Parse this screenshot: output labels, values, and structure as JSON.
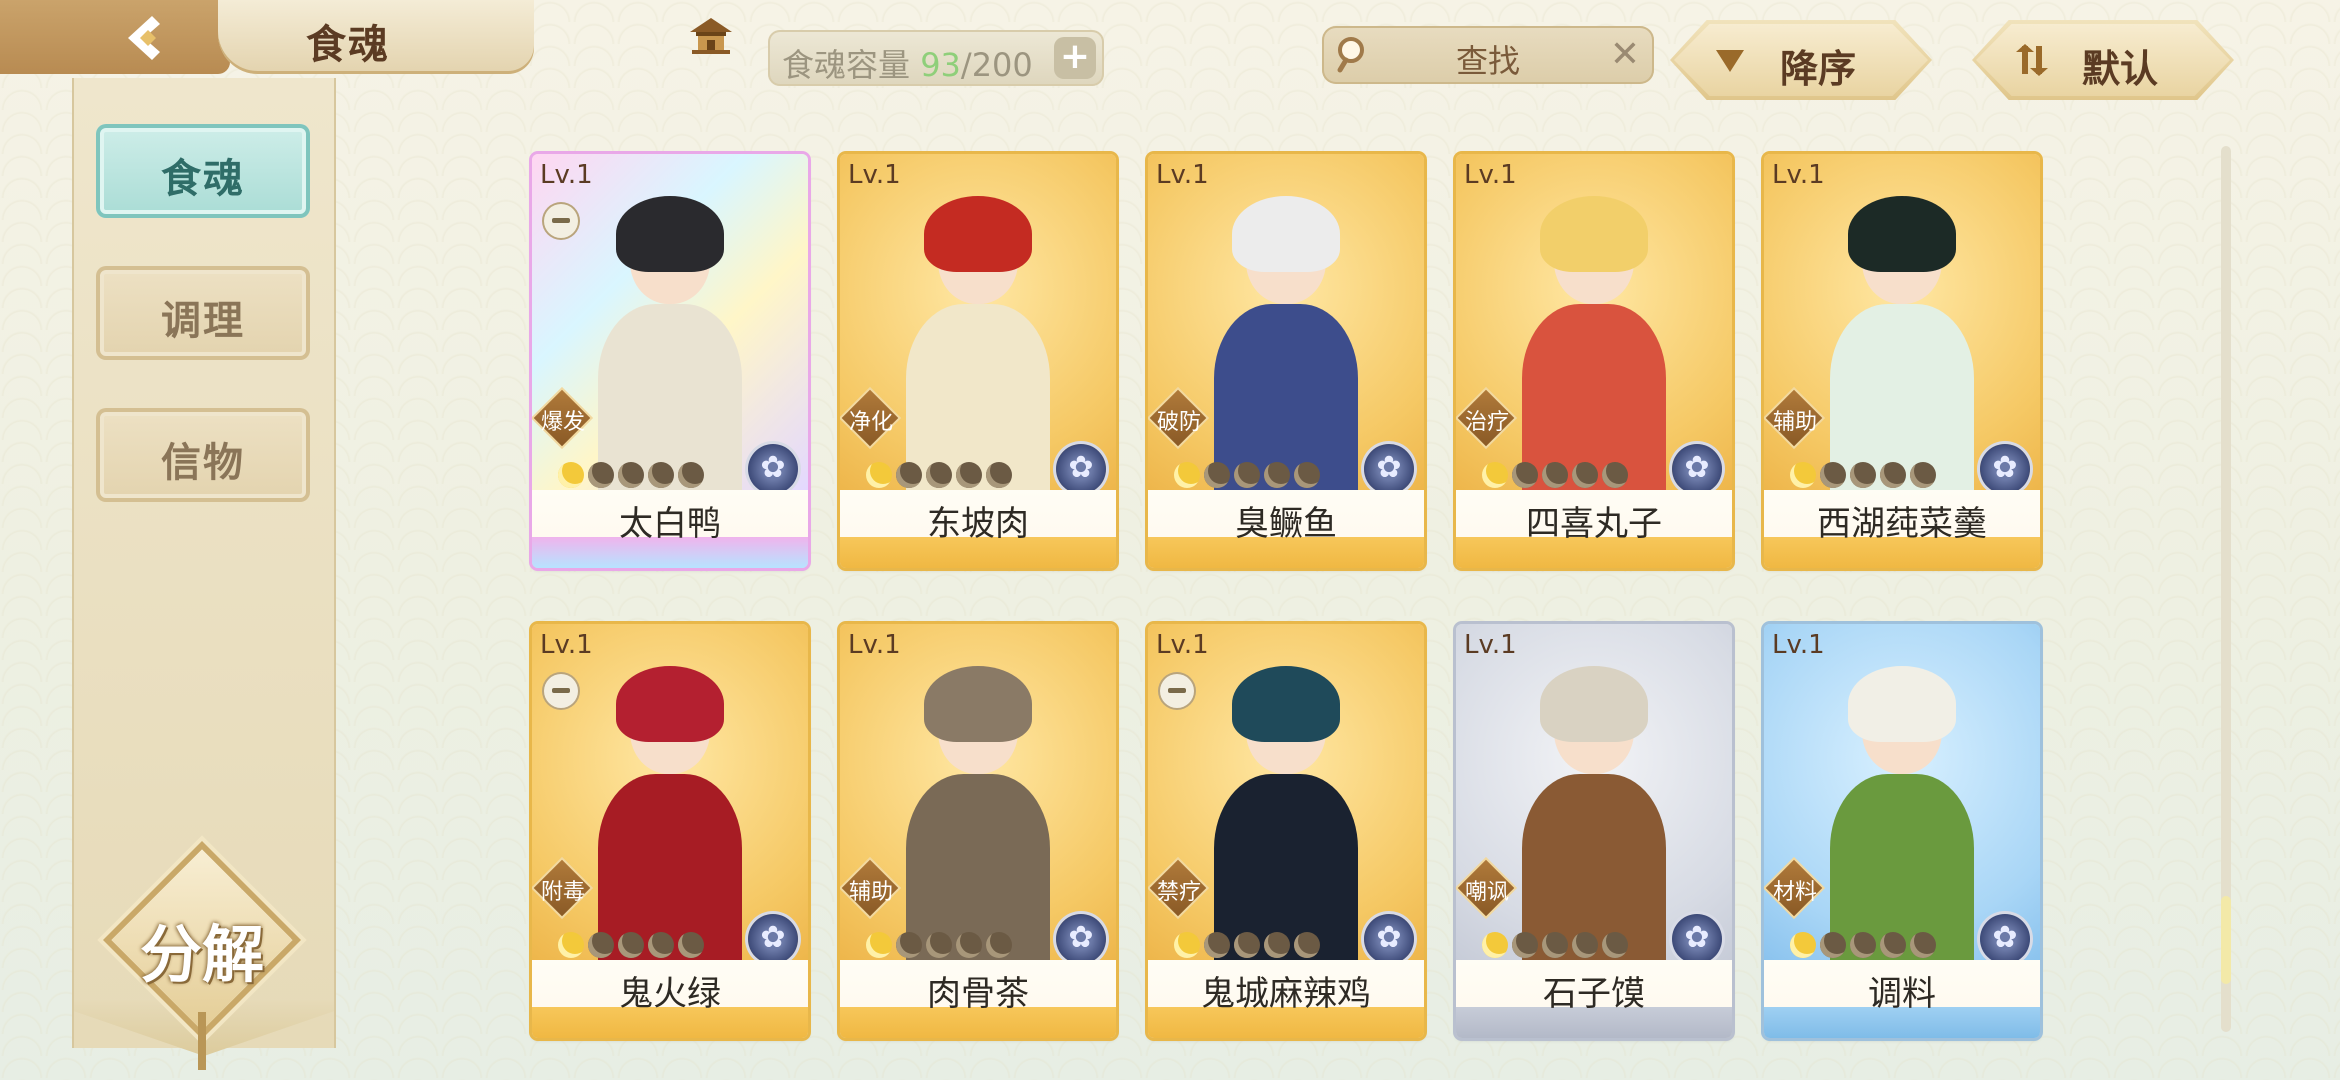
{
  "header": {
    "title": "食魂"
  },
  "capacity": {
    "label": "食魂容量",
    "current": "93",
    "max": "/200",
    "plus": "+"
  },
  "search": {
    "label": "查找",
    "clear": "✕"
  },
  "sort": {
    "order_label": "降序",
    "default_label": "默认"
  },
  "sidebar": {
    "items": [
      {
        "label": "食魂",
        "active": true
      },
      {
        "label": "调理",
        "active": false
      },
      {
        "label": "信物",
        "active": false
      }
    ],
    "decompose_label": "分解"
  },
  "cards": [
    {
      "level": "Lv.1",
      "role": "爆发",
      "name": "太白鸭",
      "stars": 1,
      "frame": "rainbow",
      "bg": "rainbow",
      "hair": "#2a2a2e",
      "outfit": "#e9e3d2",
      "cup": true
    },
    {
      "level": "Lv.1",
      "role": "净化",
      "name": "东坡肉",
      "stars": 1,
      "frame": "gold",
      "bg": "gold",
      "hair": "#c42b22",
      "outfit": "#f1e7c9",
      "cup": false
    },
    {
      "level": "Lv.1",
      "role": "破防",
      "name": "臭鳜鱼",
      "stars": 1,
      "frame": "gold",
      "bg": "gold",
      "hair": "#ececec",
      "outfit": "#3d4d8c",
      "cup": false
    },
    {
      "level": "Lv.1",
      "role": "治疗",
      "name": "四喜丸子",
      "stars": 1,
      "frame": "gold",
      "bg": "gold",
      "hair": "#f2cf6a",
      "outfit": "#d9533e",
      "cup": false
    },
    {
      "level": "Lv.1",
      "role": "辅助",
      "name": "西湖莼菜羹",
      "stars": 1,
      "frame": "gold",
      "bg": "gold",
      "hair": "#1c2a26",
      "outfit": "#e3f0e4",
      "cup": false
    },
    {
      "level": "Lv.1",
      "role": "附毒",
      "name": "鬼火绿",
      "stars": 1,
      "frame": "gold",
      "bg": "gold",
      "hair": "#b42030",
      "outfit": "#a71c24",
      "cup": true
    },
    {
      "level": "Lv.1",
      "role": "辅助",
      "name": "肉骨茶",
      "stars": 1,
      "frame": "gold",
      "bg": "gold",
      "hair": "#8a7a66",
      "outfit": "#7a6a56",
      "cup": false
    },
    {
      "level": "Lv.1",
      "role": "禁疗",
      "name": "鬼城麻辣鸡",
      "stars": 1,
      "frame": "gold",
      "bg": "gold",
      "hair": "#1f4a5a",
      "outfit": "#1a2230",
      "cup": true
    },
    {
      "level": "Lv.1",
      "role": "嘲讽",
      "name": "石子馍",
      "stars": 1,
      "frame": "silver",
      "bg": "silver",
      "hair": "#d9d2c2",
      "outfit": "#8a5a34",
      "cup": false
    },
    {
      "level": "Lv.1",
      "role": "材料",
      "name": "调料",
      "stars": 1,
      "frame": "blue",
      "bg": "blue",
      "hair": "#f1efe6",
      "outfit": "#6a9a3e",
      "cup": false
    }
  ],
  "colors": {
    "accent_teal": "#a9dcd5",
    "gold": "#f0b843",
    "capacity_current": "#8fcf7a"
  }
}
